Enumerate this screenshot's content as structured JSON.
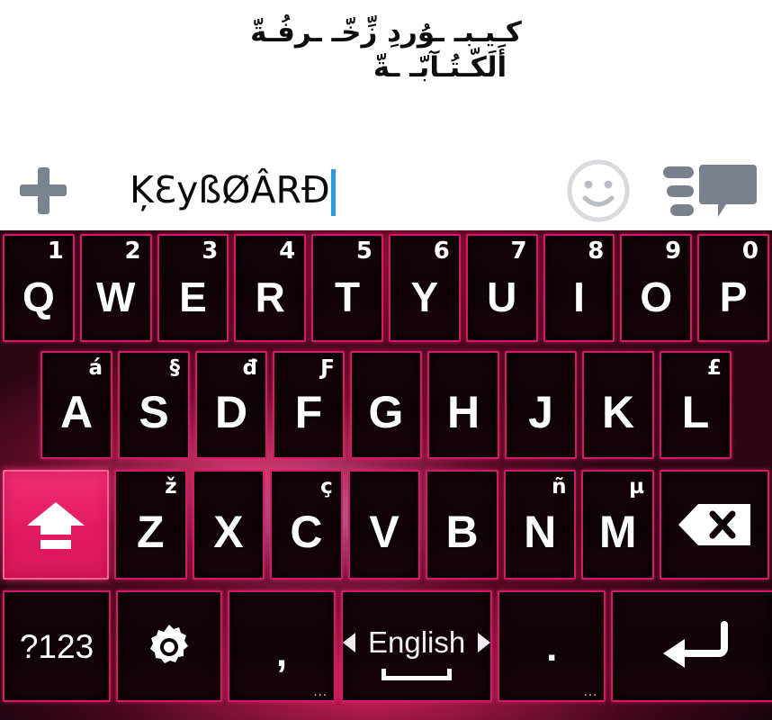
{
  "compose": {
    "line1": "كـيـبـ ـوُردِ زِّخّـ ـرفُـةّ",
    "line2": "أَلَكّـتُـآبّـ ـةّ",
    "plus_icon": "plus-icon",
    "typed_text": "ĶƐyßØÂRÐ",
    "emoji_icon": "emoji-smiley-icon",
    "send_icon": "send-message-icon"
  },
  "keyboard": {
    "accent": "#e31a62",
    "key_border": "#d6186a",
    "key_face": "#140308",
    "label_color": "#ffffff",
    "rows": [
      {
        "name": "row-qwerty",
        "keys": [
          {
            "label": "Q",
            "alt": "1"
          },
          {
            "label": "W",
            "alt": "2"
          },
          {
            "label": "E",
            "alt": "3"
          },
          {
            "label": "R",
            "alt": "4"
          },
          {
            "label": "T",
            "alt": "5"
          },
          {
            "label": "Y",
            "alt": "6"
          },
          {
            "label": "U",
            "alt": "7"
          },
          {
            "label": "I",
            "alt": "8"
          },
          {
            "label": "O",
            "alt": "9"
          },
          {
            "label": "P",
            "alt": "0"
          }
        ]
      },
      {
        "name": "row-asdf",
        "keys": [
          {
            "label": "A",
            "alt": "á"
          },
          {
            "label": "S",
            "alt": "§"
          },
          {
            "label": "D",
            "alt": "đ"
          },
          {
            "label": "F",
            "alt": "Ƒ"
          },
          {
            "label": "G",
            "alt": ""
          },
          {
            "label": "H",
            "alt": ""
          },
          {
            "label": "J",
            "alt": ""
          },
          {
            "label": "K",
            "alt": ""
          },
          {
            "label": "L",
            "alt": "£"
          }
        ]
      },
      {
        "name": "row-zxcv",
        "keys": [
          {
            "label": "Z",
            "alt": "ž"
          },
          {
            "label": "X",
            "alt": ""
          },
          {
            "label": "C",
            "alt": "ç"
          },
          {
            "label": "V",
            "alt": ""
          },
          {
            "label": "B",
            "alt": ""
          },
          {
            "label": "N",
            "alt": "ñ"
          },
          {
            "label": "M",
            "alt": "µ"
          }
        ]
      }
    ],
    "shift_key": {
      "name": "shift-key",
      "icon": "caps-lock-arrow-icon"
    },
    "backspace_key": {
      "name": "backspace-key",
      "icon": "backspace-delete-icon"
    },
    "bottom_row": {
      "symbols_label": "?123",
      "settings_icon": "gear-settings-icon",
      "comma_label": ",",
      "comma_more": "...",
      "space_language": "English",
      "space_prev_icon": "arrow-left-icon",
      "space_next_icon": "arrow-right-icon",
      "space_icon": "space-bar-icon",
      "period_label": ".",
      "period_more": "...",
      "enter_icon": "enter-return-icon"
    }
  }
}
